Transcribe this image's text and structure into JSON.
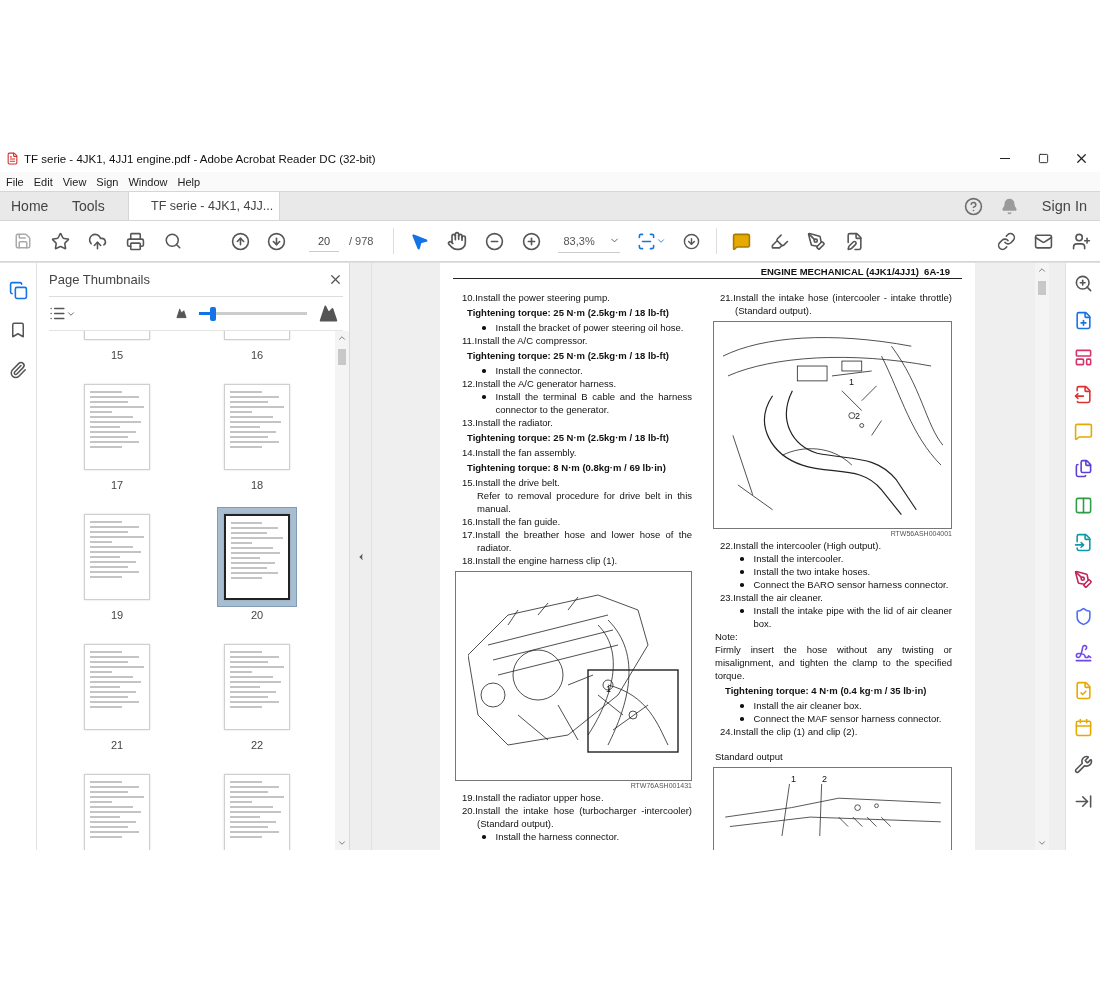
{
  "window": {
    "title": "TF serie - 4JK1, 4JJ1 engine.pdf - Adobe Acrobat Reader DC (32-bit)"
  },
  "menu": [
    "File",
    "Edit",
    "View",
    "Sign",
    "Window",
    "Help"
  ],
  "tabs": [
    {
      "label": "Home",
      "selected": false
    },
    {
      "label": "Tools",
      "selected": false
    },
    {
      "label": "TF serie - 4JK1, 4JJ...",
      "selected": true
    }
  ],
  "account": {
    "label": "Sign In"
  },
  "toolbar": {
    "page": "20",
    "page_total": "/ 978",
    "zoom": "83,3%",
    "tools": [
      {
        "kind": "select",
        "selected": true
      },
      {
        "kind": "hand",
        "selected": false
      }
    ]
  },
  "side_rail": [
    {
      "kind": "pages",
      "selected": true
    },
    {
      "kind": "bookmarks",
      "selected": false
    },
    {
      "kind": "attachments",
      "selected": false
    }
  ],
  "thumbnails": {
    "title": "Page Thumbnails",
    "size_slider": {
      "level": 0.13
    },
    "pages": [
      {
        "label": "15",
        "selected": false
      },
      {
        "label": "16",
        "selected": false
      },
      {
        "label": "17",
        "selected": false
      },
      {
        "label": "18",
        "selected": false
      },
      {
        "label": "19",
        "selected": false
      },
      {
        "label": "20",
        "selected": true
      },
      {
        "label": "21",
        "selected": false
      },
      {
        "label": "22",
        "selected": false
      },
      {
        "selected": false
      },
      {
        "selected": false
      }
    ]
  },
  "document": {
    "header": "ENGINE MECHANICAL (4JK1/4JJ1)  6A-19",
    "columns": [
      [
        {
          "kind": "step",
          "text": "10.Install the power steering pump."
        },
        {
          "kind": "torque",
          "text": "Tightening torque: 25 N·m (2.5kg·m / 18 lb-ft)"
        },
        {
          "kind": "bullet",
          "text": "Install the bracket of power steering oil hose."
        },
        {
          "kind": "step",
          "text": "11.Install the A/C compressor."
        },
        {
          "kind": "torque",
          "text": "Tightening torque: 25 N·m (2.5kg·m / 18 lb-ft)"
        },
        {
          "kind": "bullet",
          "text": "Install the connector."
        },
        {
          "kind": "step",
          "text": "12.Install the A/C generator harness."
        },
        {
          "kind": "bullet",
          "text": "Install the terminal B cable and the harness connector to the generator."
        },
        {
          "kind": "step",
          "text": "13.Install the radiator."
        },
        {
          "kind": "torque",
          "text": "Tightening torque: 25 N·m (2.5kg·m / 18 lb-ft)"
        },
        {
          "kind": "step",
          "text": "14.Install the fan assembly."
        },
        {
          "kind": "torque",
          "text": "Tightening torque: 8 N·m (0.8kg·m / 69 lb·in)"
        },
        {
          "kind": "step",
          "text": "15.Install the drive belt."
        },
        {
          "kind": "indent",
          "text": "Refer to removal procedure for drive belt in this manual."
        },
        {
          "kind": "step",
          "text": "16.Install the fan guide."
        },
        {
          "kind": "step",
          "text": "17.Install the breather hose and lower hose of the radiator."
        },
        {
          "kind": "step",
          "text": "18.Install the engine harness clip (1)."
        },
        {
          "kind": "figure",
          "callouts": [
            "1"
          ],
          "code": "RTW76ASH001431"
        },
        {
          "kind": "step",
          "text": "19.Install the radiator upper hose."
        },
        {
          "kind": "step",
          "text": "20.Install the intake hose (turbocharger -intercooler) (Standard output)."
        },
        {
          "kind": "bullet",
          "text": "Install the harness connector."
        }
      ],
      [
        {
          "kind": "step",
          "text": "21.Install the intake hose (intercooler - intake throttle) (Standard output)."
        },
        {
          "kind": "figure",
          "callouts": [
            "1",
            "2"
          ],
          "code": "RTW56ASH004001"
        },
        {
          "kind": "step",
          "text": "22.Install the intercooler (High output)."
        },
        {
          "kind": "bullet",
          "text": "Install the intercooler."
        },
        {
          "kind": "bullet",
          "text": "Install the two intake hoses."
        },
        {
          "kind": "bullet",
          "text": "Connect the BARO sensor harness connector."
        },
        {
          "kind": "step",
          "text": "23.Install the air cleaner."
        },
        {
          "kind": "bullet",
          "text": "Install the intake pipe with the lid of air cleaner box."
        },
        {
          "kind": "para",
          "text": "Note:"
        },
        {
          "kind": "para",
          "text": "Firmly insert the hose without any twisting or misalignment, and tighten the clamp to the specified torque."
        },
        {
          "kind": "torque",
          "text": "Tightening torque: 4 N·m (0.4 kg·m / 35 lb·in)"
        },
        {
          "kind": "bullet",
          "text": "Install the air cleaner box."
        },
        {
          "kind": "bullet",
          "text": "Connect the MAF sensor harness connector."
        },
        {
          "kind": "step",
          "text": "24.Install the clip (1) and clip (2)."
        },
        {
          "kind": "gap"
        },
        {
          "kind": "para",
          "text": "Standard output"
        },
        {
          "kind": "figure",
          "callouts": [
            "1",
            "2"
          ]
        }
      ]
    ]
  }
}
